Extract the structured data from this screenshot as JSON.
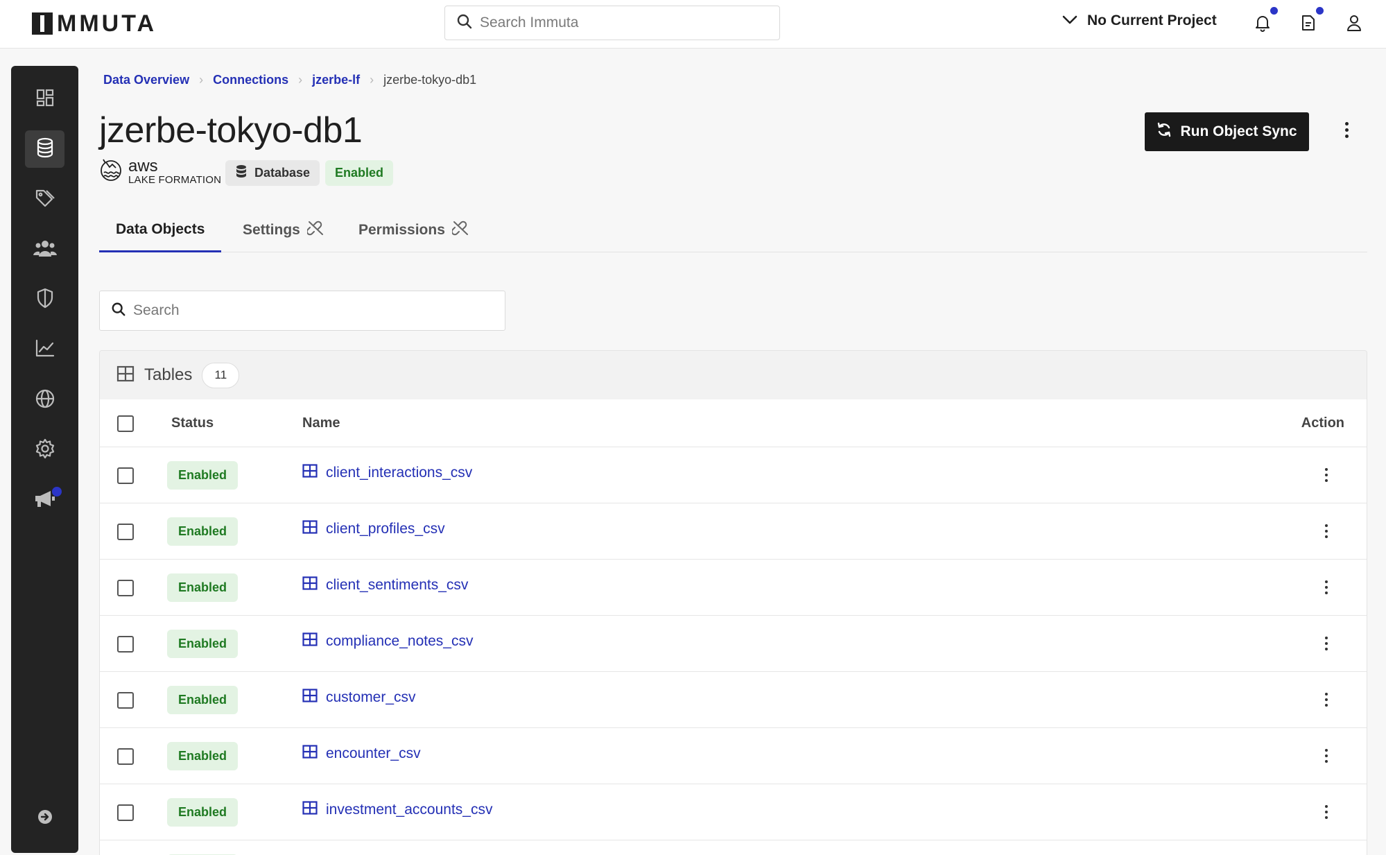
{
  "app": {
    "logo_text": "MMUTA"
  },
  "header": {
    "search_placeholder": "Search Immuta",
    "project_label": "No Current Project"
  },
  "sidebar": {
    "items": [
      {
        "icon": "dashboard-icon"
      },
      {
        "icon": "database-icon",
        "active": true
      },
      {
        "icon": "tags-icon"
      },
      {
        "icon": "people-icon"
      },
      {
        "icon": "shield-icon"
      },
      {
        "icon": "chart-icon"
      },
      {
        "icon": "globe-icon"
      },
      {
        "icon": "gear-icon"
      },
      {
        "icon": "megaphone-icon"
      }
    ],
    "collapse_icon": "arrow-right-circle-icon"
  },
  "breadcrumb": {
    "items": [
      "Data Overview",
      "Connections",
      "jzerbe-lf"
    ],
    "current": "jzerbe-tokyo-db1"
  },
  "page": {
    "title": "jzerbe-tokyo-db1",
    "provider_line1": "aws",
    "provider_line2": "LAKE FORMATION",
    "type_badge": "Database",
    "status_badge": "Enabled",
    "run_button": "Run Object Sync"
  },
  "tabs": [
    {
      "label": "Data Objects",
      "active": true
    },
    {
      "label": "Settings",
      "active": false
    },
    {
      "label": "Permissions",
      "active": false
    }
  ],
  "table_search": {
    "placeholder": "Search"
  },
  "tables_card": {
    "title": "Tables",
    "count": "11",
    "columns": {
      "status": "Status",
      "name": "Name",
      "action": "Action"
    },
    "rows": [
      {
        "status": "Enabled",
        "name": "client_interactions_csv"
      },
      {
        "status": "Enabled",
        "name": "client_profiles_csv"
      },
      {
        "status": "Enabled",
        "name": "client_sentiments_csv"
      },
      {
        "status": "Enabled",
        "name": "compliance_notes_csv"
      },
      {
        "status": "Enabled",
        "name": "customer_csv"
      },
      {
        "status": "Enabled",
        "name": "encounter_csv"
      },
      {
        "status": "Enabled",
        "name": "investment_accounts_csv"
      },
      {
        "status": "Enabled",
        "name": ""
      }
    ]
  },
  "colors": {
    "accent": "#2430b5",
    "notification_dot": "#2b35c7",
    "enabled_bg": "#e3f3e3",
    "enabled_text": "#1f7a22",
    "sidebar_bg": "#232323"
  }
}
